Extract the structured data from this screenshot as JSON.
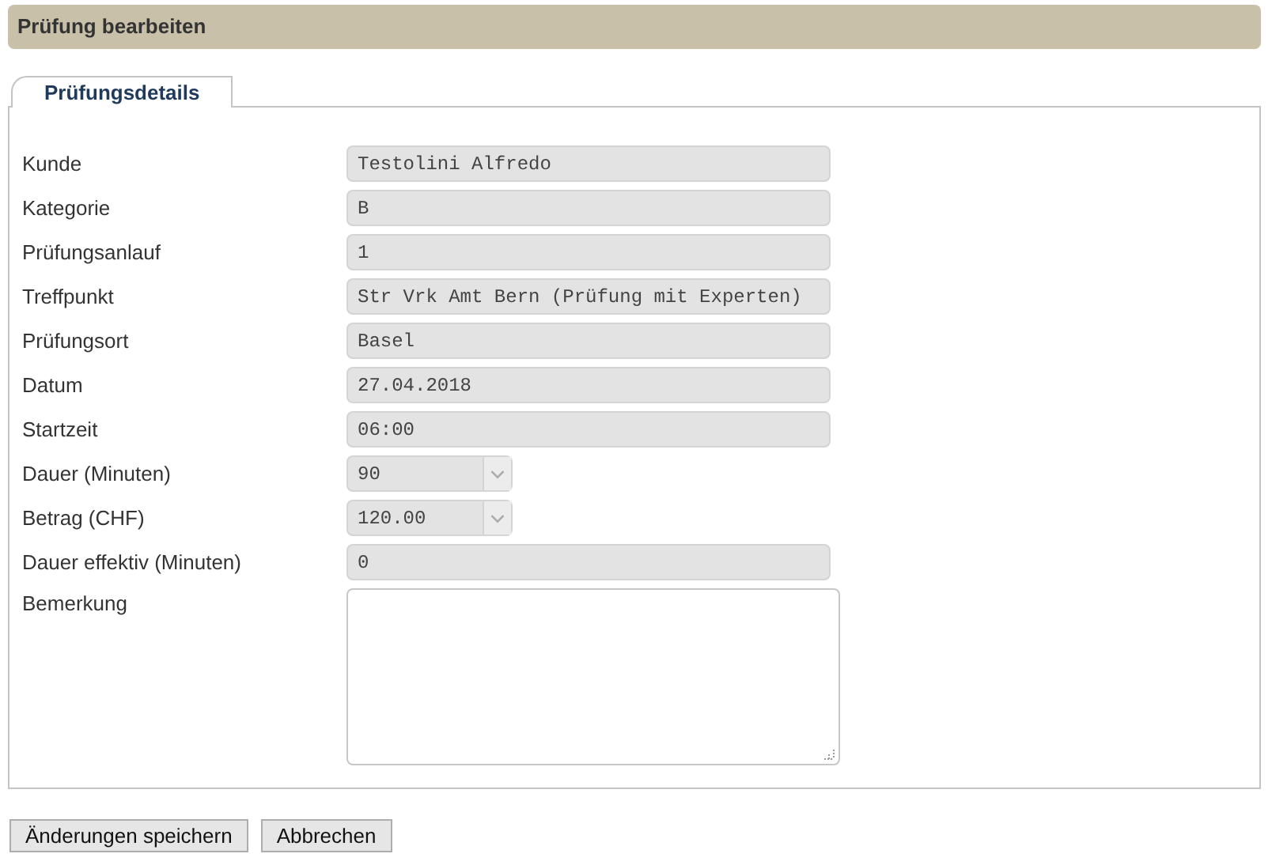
{
  "header": {
    "title": "Prüfung bearbeiten"
  },
  "tabs": [
    {
      "label": "Prüfungsdetails",
      "selected": true
    }
  ],
  "fields": [
    {
      "label": "Kunde",
      "kind": "text",
      "value": "Testolini Alfredo"
    },
    {
      "label": "Kategorie",
      "kind": "text",
      "value": "B"
    },
    {
      "label": "Prüfungsanlauf",
      "kind": "text",
      "value": "1"
    },
    {
      "label": "Treffpunkt",
      "kind": "text",
      "value": "Str Vrk Amt Bern (Prüfung mit Experten)"
    },
    {
      "label": "Prüfungsort",
      "kind": "text",
      "value": "Basel"
    },
    {
      "label": "Datum",
      "kind": "text",
      "value": "27.04.2018"
    },
    {
      "label": "Startzeit",
      "kind": "text",
      "value": "06:00"
    },
    {
      "label": "Dauer (Minuten)",
      "kind": "select",
      "value": "90"
    },
    {
      "label": "Betrag (CHF)",
      "kind": "select",
      "value": "120.00"
    },
    {
      "label": "Dauer effektiv (Minuten)",
      "kind": "text",
      "value": "0"
    },
    {
      "label": "Bemerkung",
      "kind": "textarea"
    }
  ],
  "buttons": [
    "Änderungen speichern",
    "Abbrechen"
  ]
}
